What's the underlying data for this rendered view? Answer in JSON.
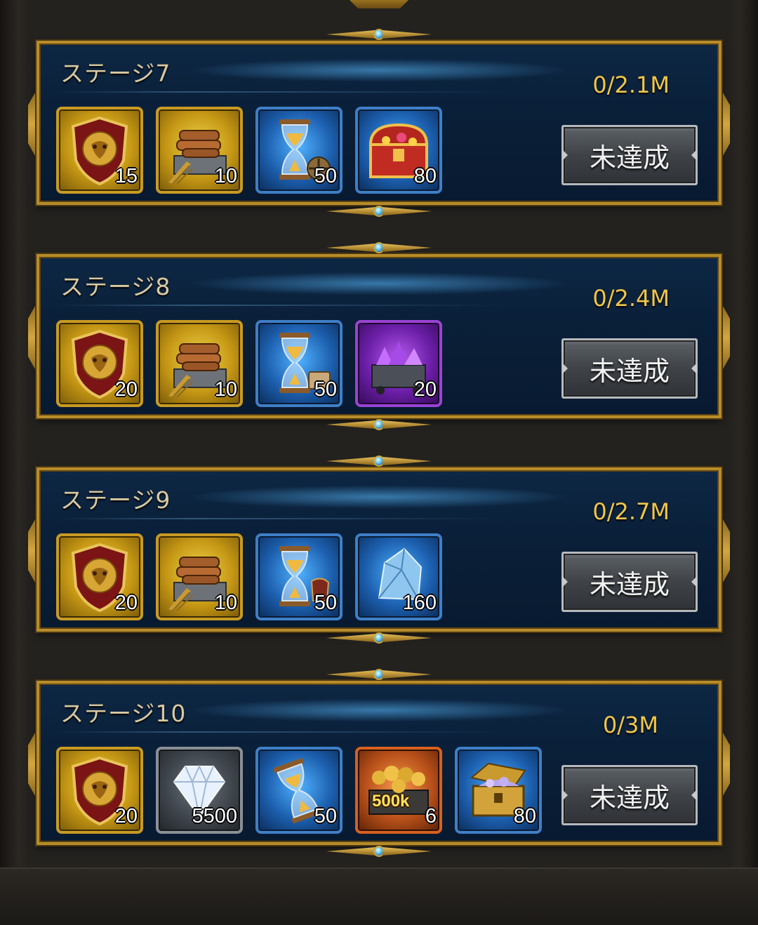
{
  "stages": [
    {
      "title": "ステージ7",
      "progress": "0/2.1M",
      "status": "未達成",
      "rewards": [
        {
          "icon": "lion-shield-icon",
          "frame": "gold",
          "qty": "15"
        },
        {
          "icon": "resource-crate-icon",
          "frame": "gold",
          "qty": "10"
        },
        {
          "icon": "hourglass-speedup-icon",
          "frame": "blue",
          "qty": "50"
        },
        {
          "icon": "treasure-chest-icon",
          "frame": "blue",
          "qty": "80"
        }
      ]
    },
    {
      "title": "ステージ8",
      "progress": "0/2.4M",
      "status": "未達成",
      "rewards": [
        {
          "icon": "lion-shield-icon",
          "frame": "gold",
          "qty": "20"
        },
        {
          "icon": "resource-crate-icon",
          "frame": "gold",
          "qty": "10"
        },
        {
          "icon": "hourglass-speedup-icon",
          "frame": "blue",
          "qty": "50"
        },
        {
          "icon": "purple-gem-cart-icon",
          "frame": "purple",
          "qty": "20"
        }
      ]
    },
    {
      "title": "ステージ9",
      "progress": "0/2.7M",
      "status": "未達成",
      "rewards": [
        {
          "icon": "lion-shield-icon",
          "frame": "gold",
          "qty": "20"
        },
        {
          "icon": "resource-crate-icon",
          "frame": "gold",
          "qty": "10"
        },
        {
          "icon": "hourglass-speedup-icon",
          "frame": "blue",
          "qty": "50"
        },
        {
          "icon": "crystal-ore-icon",
          "frame": "blue",
          "qty": "160"
        }
      ]
    },
    {
      "title": "ステージ10",
      "progress": "0/3M",
      "status": "未達成",
      "rewards": [
        {
          "icon": "lion-shield-icon",
          "frame": "gold",
          "qty": "20"
        },
        {
          "icon": "diamond-icon",
          "frame": "grey",
          "qty": "5500"
        },
        {
          "icon": "hourglass-speedup-icon",
          "frame": "blue",
          "qty": "50"
        },
        {
          "icon": "gold-coins-cart-icon",
          "frame": "orange",
          "qty": "6",
          "tag": "500k"
        },
        {
          "icon": "open-chest-icon",
          "frame": "blue",
          "qty": "80"
        }
      ]
    }
  ]
}
